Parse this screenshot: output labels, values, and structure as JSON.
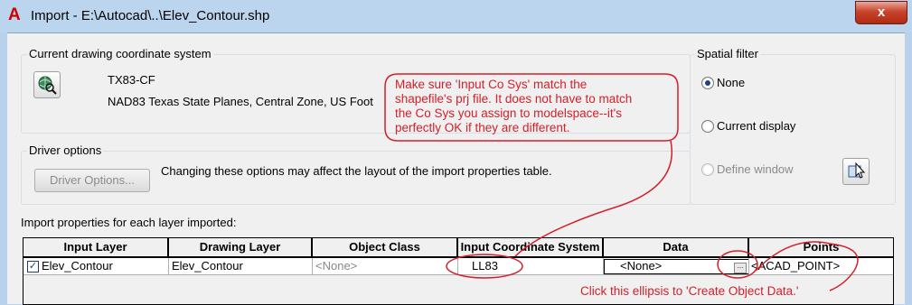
{
  "window": {
    "title": "Import - E:\\Autocad\\..\\Elev_Contour.shp",
    "app_icon": "A",
    "close_label": "x"
  },
  "coordinate_system": {
    "group_label": "Current drawing coordinate system",
    "code": "TX83-CF",
    "description": "NAD83 Texas State Planes, Central Zone, US Foot"
  },
  "driver_options": {
    "group_label": "Driver options",
    "button_label": "Driver Options...",
    "note": "Changing these options may affect the layout of the import properties table."
  },
  "spatial_filter": {
    "group_label": "Spatial filter",
    "options": [
      {
        "label": "None",
        "checked": true,
        "enabled": true
      },
      {
        "label": "Current display",
        "checked": false,
        "enabled": true
      },
      {
        "label": "Define window",
        "checked": false,
        "enabled": false
      }
    ]
  },
  "layers": {
    "label": "Import properties for each layer imported:",
    "columns": [
      "Input Layer",
      "Drawing Layer",
      "Object Class",
      "Input Coordinate System",
      "Data",
      "Points"
    ],
    "rows": [
      {
        "checked": true,
        "input_layer": "Elev_Contour",
        "drawing_layer": "Elev_Contour",
        "object_class": "<None>",
        "input_coordinate_system": "LL83",
        "data": "<None>",
        "points": "<ACAD_POINT>"
      }
    ]
  },
  "annotations": {
    "cosys_note": [
      "Make sure 'Input Co Sys' match the",
      "shapefile's prj file. It does not have to match",
      "the Co Sys you assign to modelspace--it's",
      "perfectly OK if they are different."
    ],
    "ellipsis_note": "Click this ellipsis to 'Create Object Data.'",
    "color": "#d4202b"
  }
}
